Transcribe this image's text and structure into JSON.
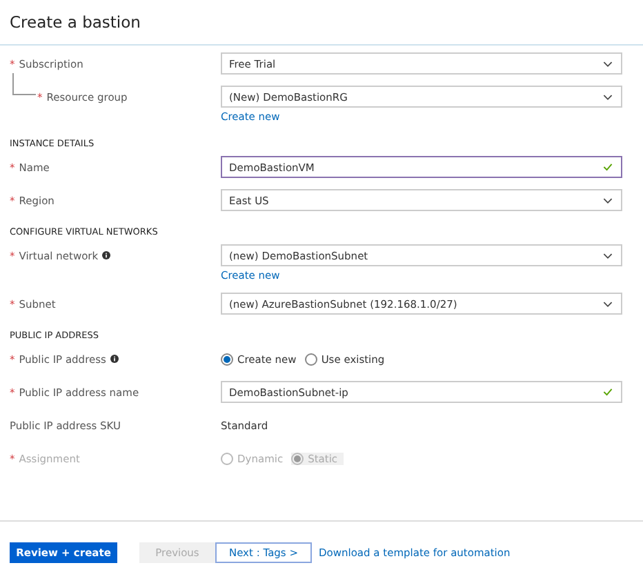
{
  "title": "Create a bastion",
  "rows": [
    {
      "kind": "select",
      "label": "Subscription",
      "required_mark": "*",
      "value": "Free Trial",
      "children": [
        {
          "kind": "select",
          "label": "Resource group",
          "required_mark": "*",
          "value": "(New) DemoBastionRG",
          "link": "Create new"
        }
      ]
    },
    {
      "kind": "section",
      "label": "INSTANCE DETAILS"
    },
    {
      "kind": "text",
      "label": "Name",
      "required_mark": "*",
      "value": "DemoBastionVM",
      "focused": true,
      "valid": true
    },
    {
      "kind": "select",
      "label": "Region",
      "required_mark": "*",
      "value": "East US"
    },
    {
      "kind": "section",
      "label": "CONFIGURE VIRTUAL NETWORKS"
    },
    {
      "kind": "select",
      "label": "Virtual network",
      "required_mark": "*",
      "info": true,
      "value": "(new) DemoBastionSubnet",
      "link": "Create new"
    },
    {
      "kind": "select",
      "label": "Subnet",
      "required_mark": "*",
      "value": "(new) AzureBastionSubnet (192.168.1.0/27)"
    },
    {
      "kind": "section",
      "label": "PUBLIC IP ADDRESS"
    },
    {
      "kind": "radio",
      "label": "Public IP address",
      "required_mark": "*",
      "info": true,
      "disabled": false,
      "options": [
        {
          "label": "Create new",
          "selected": true
        },
        {
          "label": "Use existing",
          "selected": false
        }
      ]
    },
    {
      "kind": "text",
      "label": "Public IP address name",
      "required_mark": "*",
      "value": "DemoBastionSubnet-ip",
      "focused": false,
      "valid": true
    },
    {
      "kind": "static",
      "label": "Public IP address SKU",
      "value": "Standard"
    },
    {
      "kind": "radio",
      "label": "Assignment",
      "required_mark": "*",
      "disabled": true,
      "options": [
        {
          "label": "Dynamic",
          "selected": false
        },
        {
          "label": "Static",
          "selected": true
        }
      ]
    }
  ],
  "footer": {
    "primary": "Review + create",
    "previous": "Previous",
    "previous_disabled": true,
    "next": "Next : Tags >",
    "link": "Download a template for automation"
  }
}
